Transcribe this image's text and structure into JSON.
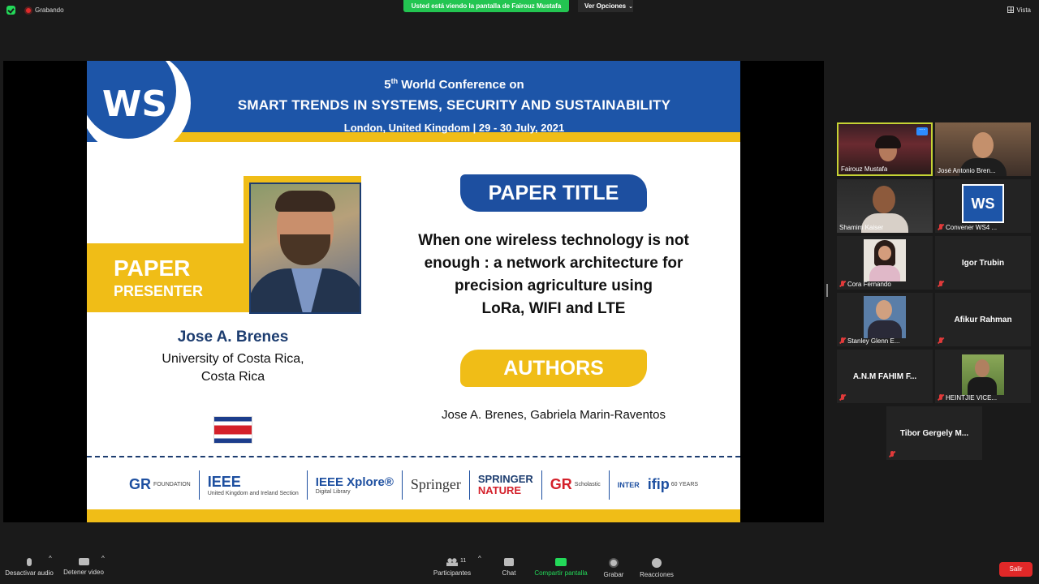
{
  "topbar": {
    "recording_label": "Grabando",
    "share_banner": "Usted está viendo la pantalla de Fairouz Mustafa",
    "view_options": "Ver Opciones",
    "view_label": "Vista"
  },
  "slide": {
    "logo": "WS",
    "conf_edition_num": "5",
    "conf_edition_sup": "th",
    "conf_line1": "World Conference on",
    "conf_line2": "SMART TRENDS IN SYSTEMS, SECURITY AND SUSTAINABILITY",
    "conf_line3": "London, United Kingdom  |  29 - 30 July, 2021",
    "paper_label": "PAPER",
    "presenter_label": "PRESENTER",
    "presenter_name": "Jose A. Brenes",
    "presenter_affil_line1": "University of Costa Rica,",
    "presenter_affil_line2": "Costa Rica",
    "paper_title_heading": "PAPER TITLE",
    "paper_title_line1": "When one wireless technology is not",
    "paper_title_line2": "enough : a network architecture for",
    "paper_title_line3": "precision agriculture using",
    "paper_title_line4": "LoRa, WIFI and LTE",
    "authors_heading": "AUTHORS",
    "authors": "Jose A. Brenes, Gabriela Marin-Raventos",
    "sponsors": {
      "gr": "GR",
      "gr_sub": "FOUNDATION",
      "ieee": "IEEE",
      "ieee_sub": "United Kingdom and Ireland Section",
      "xplore": "IEEE Xplore®",
      "xplore_sub": "Digital Library",
      "springer": "Springer",
      "springer_nature_1": "SPRINGER",
      "springer_nature_2": "NATURE",
      "gr_scholastic": "GR",
      "gr_scholastic_sub": "Scholastic",
      "inter": "INTER",
      "ifip": "ifip",
      "ifip_sub": "60 YEARS"
    }
  },
  "participants": [
    {
      "name": "Fairouz Mustafa",
      "type": "video",
      "active": true
    },
    {
      "name": "José Antonio Bren...",
      "type": "video"
    },
    {
      "name": "Shamim Kaiser",
      "type": "video"
    },
    {
      "name": "Convener WS4 ...",
      "type": "logo",
      "muted": true
    },
    {
      "name": "Cora Fernando",
      "type": "photo",
      "muted": true
    },
    {
      "name": "Igor Trubin",
      "type": "text",
      "muted": true
    },
    {
      "name": "Stanley Glenn E...",
      "type": "photo",
      "muted": true
    },
    {
      "name": "Afikur Rahman",
      "type": "text",
      "muted": true
    },
    {
      "name": "A.N.M FAHIM F...",
      "type": "text",
      "muted": true
    },
    {
      "name": "HEINTJIE VICE...",
      "type": "photo",
      "muted": true
    },
    {
      "name": "Tibor Gergely M...",
      "type": "text",
      "muted": true
    }
  ],
  "toolbar": {
    "mute_audio": "Desactivar audio",
    "stop_video": "Detener video",
    "participants": "Participantes",
    "participants_count": "11",
    "chat": "Chat",
    "share_screen": "Compartir pantalla",
    "record": "Grabar",
    "reactions": "Reacciones",
    "leave": "Salir"
  },
  "colors": {
    "share_green": "#23c551",
    "slide_blue": "#1d55a8",
    "slide_yellow": "#f0bd17",
    "leave_red": "#e02828",
    "active_border": "#c6d334"
  }
}
